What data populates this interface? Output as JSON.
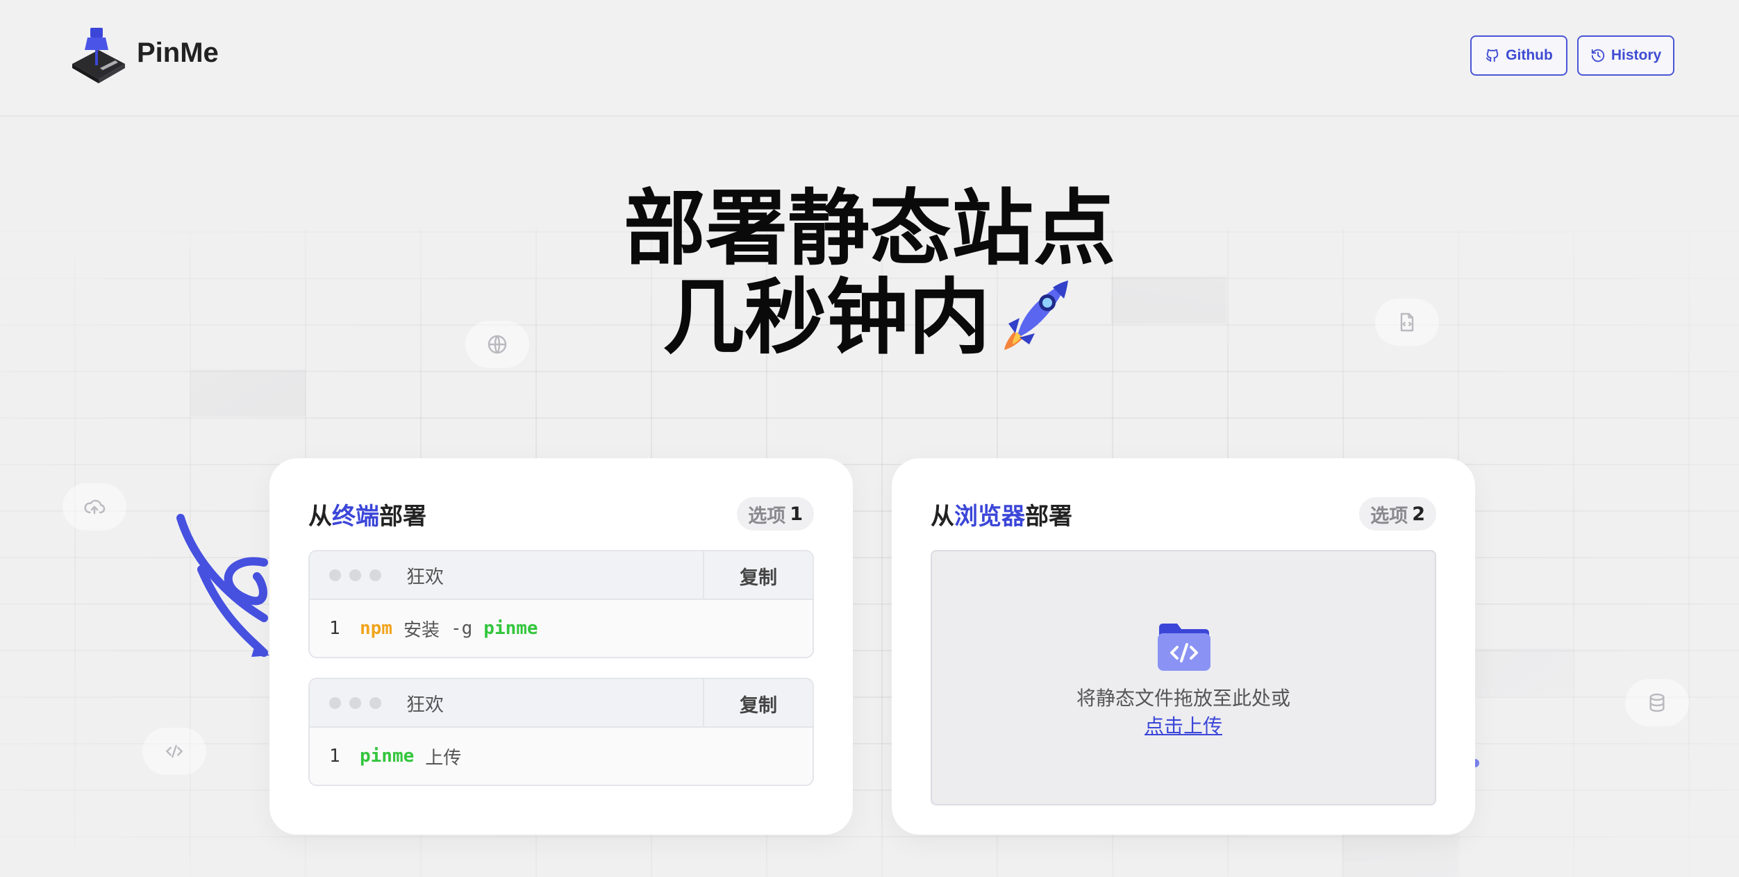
{
  "header": {
    "brand": "PinMe",
    "buttons": [
      {
        "label": "Github",
        "icon": "github-icon"
      },
      {
        "label": "History",
        "icon": "history-icon"
      }
    ]
  },
  "hero": {
    "line1": "部署静态站点",
    "line2": "几秒钟内",
    "emoji_icon": "rocket-icon"
  },
  "terminal_card": {
    "title_prefix": "从",
    "title_accent": "终端",
    "title_suffix": "部署",
    "option_label": "选项",
    "option_num": "1",
    "snippets": [
      {
        "label": "狂欢",
        "copy": "复制",
        "line_no": "1",
        "tokens": [
          "npm",
          "安装",
          "-g",
          "pinme"
        ]
      },
      {
        "label": "狂欢",
        "copy": "复制",
        "line_no": "1",
        "tokens": [
          "pinme",
          "上传"
        ]
      }
    ]
  },
  "browser_card": {
    "title_prefix": "从",
    "title_accent": "浏览器",
    "title_suffix": "部署",
    "option_label": "选项",
    "option_num": "2",
    "drop_text": "将静态文件拖放至此处或",
    "drop_link": "点击上传"
  },
  "colors": {
    "accent": "#3b46d8",
    "npm": "#f0a41c",
    "command": "#33c63d",
    "background": "#f0f0f1"
  },
  "floating_icons": [
    "globe-icon",
    "file-code-icon",
    "cloud-upload-icon",
    "code-icon",
    "database-icon"
  ]
}
